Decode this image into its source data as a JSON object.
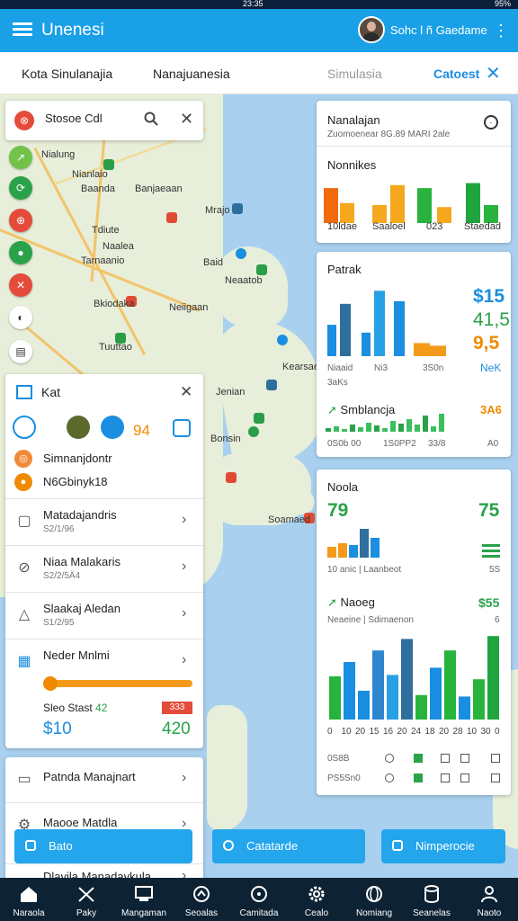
{
  "status_bar": {
    "time": "23:35",
    "right": "95%"
  },
  "app_bar": {
    "title": "Unenesi",
    "user": "Sohc l ñ Gaedame"
  },
  "tabs": {
    "t1": "Kota Sinulanajia",
    "t2": "Nanajuanesia",
    "t3": "Simulasia",
    "t4": "Catoest"
  },
  "search": {
    "text": "Stosoe Cdl"
  },
  "map_labels": [
    "Nialung",
    "Nianlaio",
    "Baanda",
    "Banjaeaan",
    "Tdiute",
    "Mrajo",
    "Naalea",
    "Tarnaanio",
    "Bkiodaka",
    "Neiigaan",
    "Tuuttao",
    "Baid",
    "Neaatob",
    "Kearsaeo",
    "Jenian",
    "Bonsin",
    "Soamaed"
  ],
  "panel": {
    "title": "Kat",
    "count": "94",
    "list": [
      "Simnanjdontr",
      "N6Gbinyk18"
    ],
    "rows": [
      {
        "title": "Matadajandris",
        "sub": "S2/1/96"
      },
      {
        "title": "Niaa Malakaris",
        "sub": "S2/2/5Ä4"
      },
      {
        "title": "Slaakaj Aledan",
        "sub": "S1/2/95"
      },
      {
        "title": "Neder Mnlmi",
        "sub": ""
      }
    ],
    "slider_level": 0.95,
    "slider_label": "Sleo Stast",
    "slider_value": "42",
    "price_left": "$10",
    "price_right": "420",
    "badge": "333"
  },
  "sheet": {
    "row1": "Patnda Manajnart",
    "row2": "Maooe Matdla",
    "row3": "Dlavila Manadavkula"
  },
  "float_buttons": {
    "b1": "Bato",
    "b2": "Catatarde",
    "b3": "Nimperocie"
  },
  "right_card_1": {
    "title": "Nanalajan",
    "sub": "Zuomoenear 8G.89 MARI 2ale",
    "section": "Nonnikes",
    "labels": [
      "10ldae",
      "Saaloel",
      "023",
      "Staedad"
    ],
    "colors": [
      "#f06a0a",
      "#f5a81d",
      "#28b43c",
      "#1fa43e"
    ]
  },
  "right_card_2": {
    "title": "Patrak",
    "values": [
      "$15",
      "41,5",
      "9,5",
      "NeK"
    ],
    "labels": [
      "Niaaid",
      "Ni3",
      "3S0n",
      "3aKs"
    ],
    "section": "Smblancja",
    "section_value": "3A6",
    "footer": [
      "0S0b 00",
      "1S0PP2",
      "33/8",
      "A0"
    ]
  },
  "right_card_3": {
    "title": "Noola",
    "value_left": "79",
    "value_right": "75",
    "sub": "10 anic | Laanbeot",
    "sub_right": "5S",
    "section": "Naoeg",
    "section_value": "$55",
    "section_sub": "Neaeine | Sdimaenon",
    "section_sub_right": "6",
    "axis": [
      "0",
      "10",
      "20",
      "15",
      "16",
      "20",
      "24",
      "18",
      "20",
      "28",
      "10",
      "30",
      "0"
    ],
    "row_a": "0S8B",
    "row_b": "PS5Sn0"
  },
  "chart_data": [
    {
      "type": "bar",
      "title": "Nonnikes",
      "categories": [
        "10ldae",
        "Saaloel",
        "023",
        "Staedad"
      ],
      "series": [
        {
          "values": [
            35,
            18,
            35,
            40
          ]
        },
        {
          "values": [
            20,
            38,
            16,
            18
          ]
        },
        {
          "values": [
            0,
            0,
            38,
            0
          ]
        },
        {
          "values": [
            0,
            0,
            0,
            42
          ]
        }
      ],
      "ylim": [
        0,
        45
      ]
    },
    {
      "type": "bar",
      "title": "Patrak",
      "categories": [
        "Niaaid",
        "Ni3",
        "3S0n",
        "3aKs"
      ],
      "values": [
        24,
        40,
        18,
        50,
        42,
        10,
        8
      ],
      "ylim": [
        0,
        55
      ]
    },
    {
      "type": "bar",
      "title": "Noola",
      "values": [
        6,
        8,
        7,
        16,
        11
      ],
      "ylim": [
        0,
        20
      ]
    },
    {
      "type": "bar",
      "title": "Naoeg",
      "values": [
        30,
        40,
        20,
        48,
        31,
        56,
        17,
        36,
        48,
        16,
        28,
        58
      ],
      "ylim": [
        0,
        60
      ]
    }
  ],
  "bottom_nav": [
    "Naraola",
    "Paky",
    "Mangaman",
    "Seoalas",
    "Camitada",
    "Cealo",
    "Nomiang",
    "Seanelas",
    "Naoto"
  ]
}
